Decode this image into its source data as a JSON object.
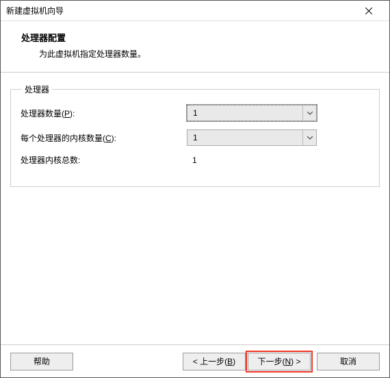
{
  "window": {
    "title": "新建虚拟机向导"
  },
  "header": {
    "title": "处理器配置",
    "subtitle": "为此虚拟机指定处理器数量。"
  },
  "group": {
    "legend": "处理器",
    "rows": {
      "cpu_count": {
        "label_pre": "处理器数量(",
        "label_ul": "P",
        "label_post": "):",
        "value": "1"
      },
      "cores_per_cpu": {
        "label_pre": "每个处理器的内核数量(",
        "label_ul": "C",
        "label_post": "):",
        "value": "1"
      },
      "total_cores": {
        "label": "处理器内核总数:",
        "value": "1"
      }
    }
  },
  "footer": {
    "help": "帮助",
    "back_pre": "< 上一步(",
    "back_ul": "B",
    "back_post": ")",
    "next_pre": "下一步(",
    "next_ul": "N",
    "next_post": ") >",
    "cancel": "取消"
  }
}
